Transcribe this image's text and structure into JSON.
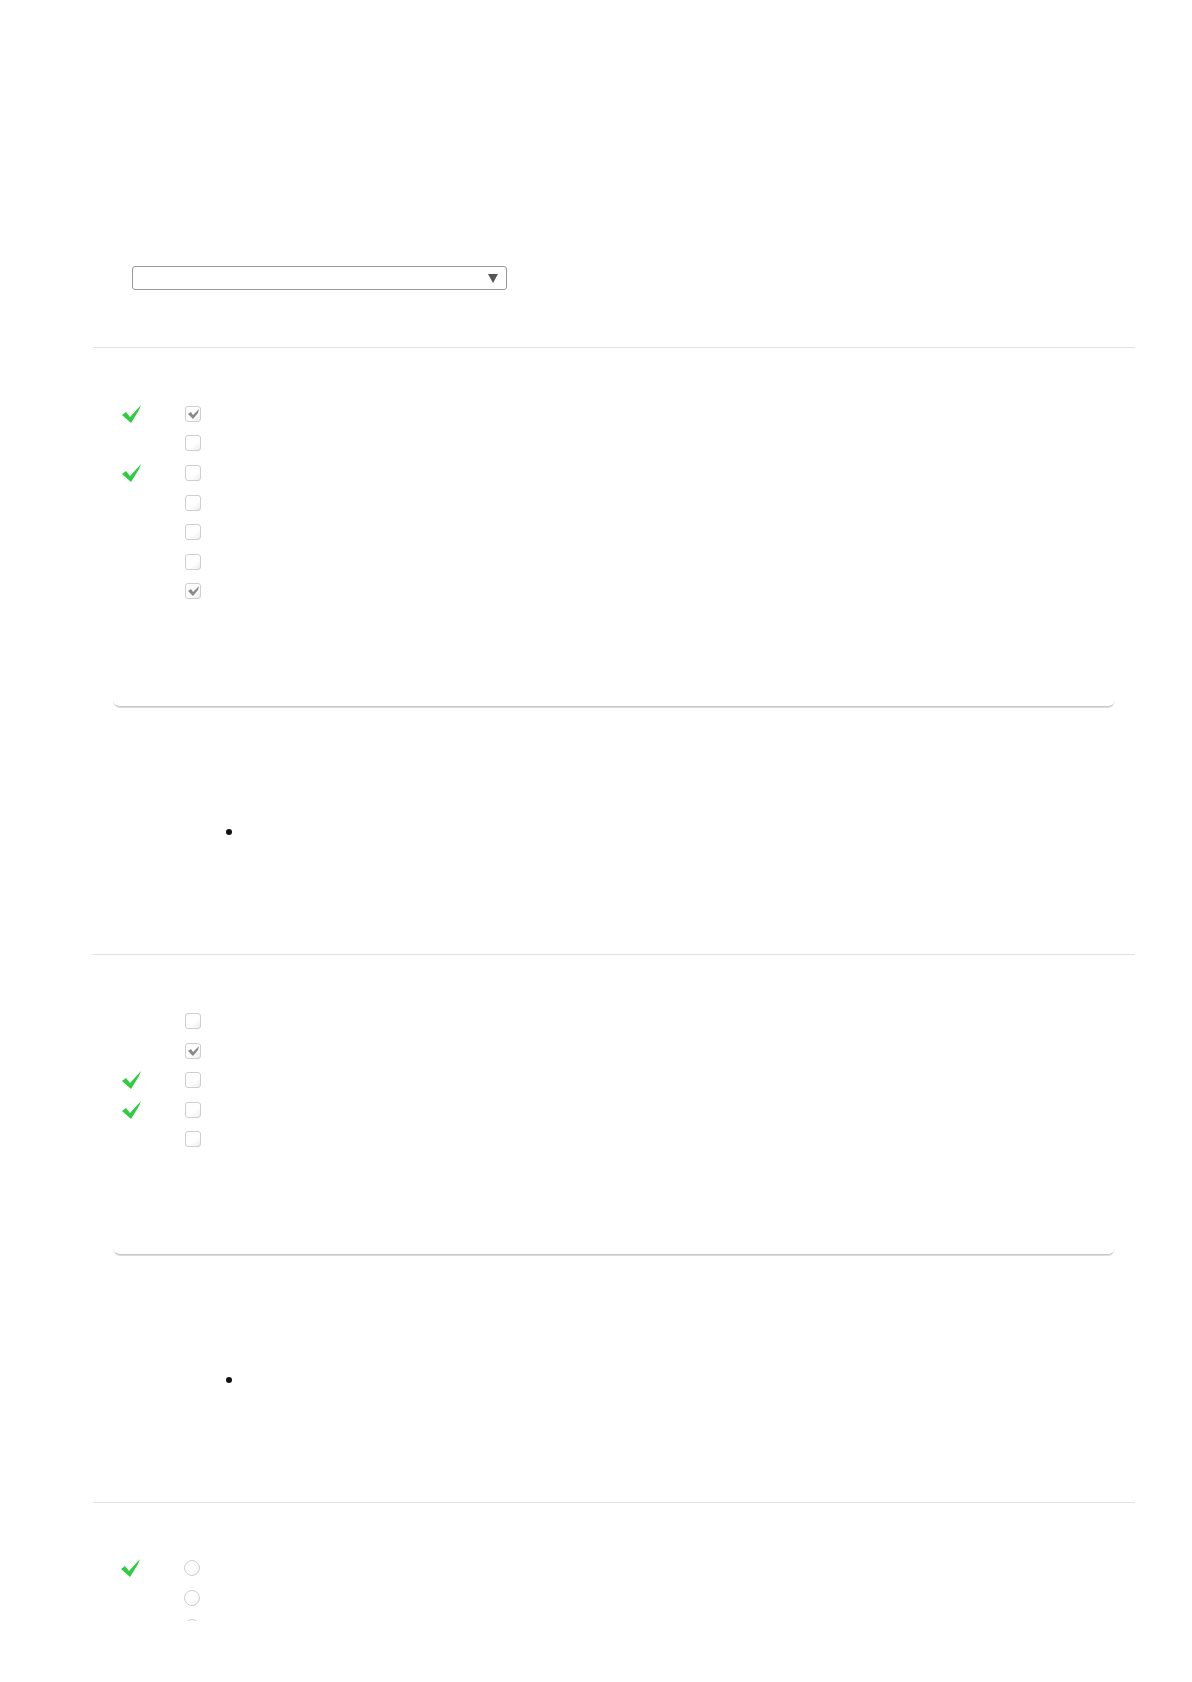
{
  "dropdown": {
    "kind": "select"
  },
  "questions": [
    {
      "kind": "checkbox",
      "clipped": false,
      "options": [
        {
          "checked": true,
          "correct": true
        },
        {
          "checked": false,
          "correct": false
        },
        {
          "checked": false,
          "correct": true
        },
        {
          "checked": false,
          "correct": false
        },
        {
          "checked": false,
          "correct": false
        },
        {
          "checked": false,
          "correct": false
        },
        {
          "checked": true,
          "correct": false
        }
      ],
      "feedback": {
        "items": [
          {
            "kind": "bullet"
          }
        ]
      }
    },
    {
      "kind": "checkbox",
      "clipped": false,
      "options": [
        {
          "checked": false,
          "correct": false
        },
        {
          "checked": true,
          "correct": false
        },
        {
          "checked": false,
          "correct": true
        },
        {
          "checked": false,
          "correct": true
        },
        {
          "checked": false,
          "correct": false
        }
      ],
      "feedback": {
        "items": [
          {
            "kind": "bullet"
          }
        ]
      }
    },
    {
      "kind": "radio",
      "clipped": true,
      "options": [
        {
          "checked": false,
          "correct": true
        },
        {
          "checked": false,
          "correct": false
        },
        {
          "correct": false
        }
      ]
    }
  ]
}
